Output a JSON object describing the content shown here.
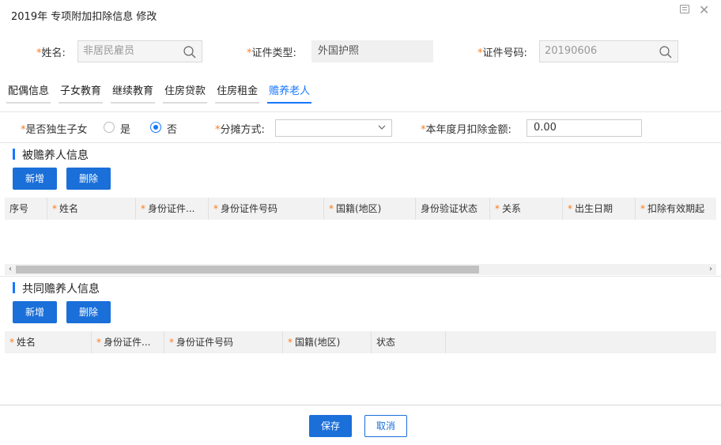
{
  "window": {
    "title": "2019年 专项附加扣除信息 修改",
    "icons": [
      "restore-icon",
      "close-icon"
    ]
  },
  "info": {
    "name_label": "姓名:",
    "name_value": "非居民雇员",
    "id_type_label": "证件类型:",
    "id_type_value": "外国护照",
    "id_number_label": "证件号码:",
    "id_number_value": "20190606",
    "required_mark": "*"
  },
  "tabs": [
    {
      "label": "配偶信息",
      "active": false
    },
    {
      "label": "子女教育",
      "active": false
    },
    {
      "label": "继续教育",
      "active": false
    },
    {
      "label": "住房贷款",
      "active": false
    },
    {
      "label": "住房租金",
      "active": false
    },
    {
      "label": "赡养老人",
      "active": true
    }
  ],
  "options": {
    "only_child_label": "是否独生子女",
    "yes_label": "是",
    "no_label": "否",
    "selected": "否",
    "split_label": "分摊方式:",
    "split_value": "",
    "amount_label": "本年度月扣除金额:",
    "amount_value": "0.00"
  },
  "dependents": {
    "title": "被赡养人信息",
    "add_label": "新增",
    "delete_label": "删除",
    "columns": [
      {
        "label": "序号",
        "required": false
      },
      {
        "label": "姓名",
        "required": true
      },
      {
        "label": "身份证件...",
        "required": true
      },
      {
        "label": "身份证件号码",
        "required": true
      },
      {
        "label": "国籍(地区)",
        "required": true
      },
      {
        "label": "身份验证状态",
        "required": false
      },
      {
        "label": "关系",
        "required": true
      },
      {
        "label": "出生日期",
        "required": true
      },
      {
        "label": "扣除有效期起",
        "required": true
      }
    ],
    "rows": []
  },
  "co_supporters": {
    "title": "共同赡养人信息",
    "add_label": "新增",
    "delete_label": "删除",
    "columns": [
      {
        "label": "姓名",
        "required": true
      },
      {
        "label": "身份证件...",
        "required": true
      },
      {
        "label": "身份证件号码",
        "required": true
      },
      {
        "label": "国籍(地区)",
        "required": true
      },
      {
        "label": "状态",
        "required": false
      }
    ],
    "rows": []
  },
  "footer": {
    "save_label": "保存",
    "cancel_label": "取消"
  },
  "colors": {
    "accent": "#1677ff",
    "button": "#1a6fd9",
    "required": "#ff7a1a"
  }
}
